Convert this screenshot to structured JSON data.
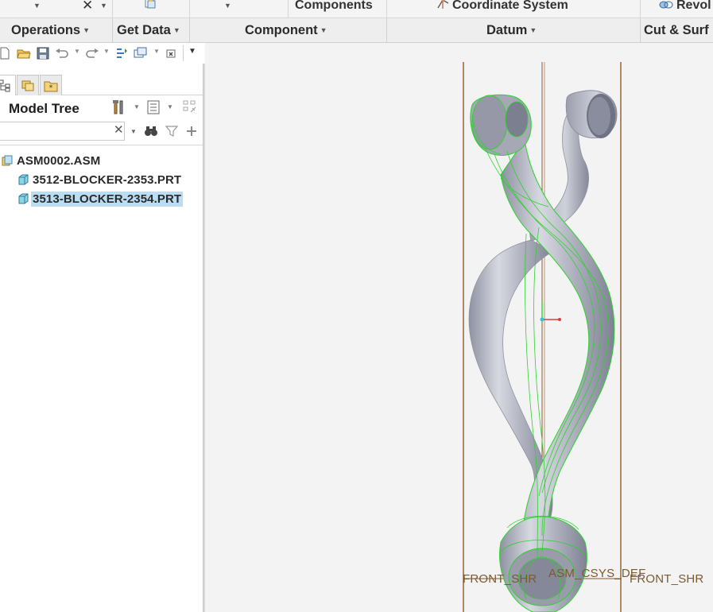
{
  "ribbon_top": {
    "components_label": "Components",
    "coordinate_system_label": "Coordinate System",
    "revolve_label": "Revol"
  },
  "ribbon_groups": {
    "operations": "Operations",
    "get_data": "Get Data",
    "component": "Component",
    "datum": "Datum",
    "cut_surface": "Cut & Surf"
  },
  "quick_access_icons": [
    "new-file-icon",
    "open-file-icon",
    "save-icon",
    "undo-icon",
    "redo-icon",
    "regenerate-icon",
    "windows-icon",
    "close-window-icon",
    "customize-icon"
  ],
  "panel_tabs": [
    "model-tree-tab-icon",
    "folder-browser-tab-icon",
    "favorites-tab-icon"
  ],
  "model_tree": {
    "title": "Model Tree",
    "search_value": "",
    "nodes": [
      {
        "label": "ASM0002.ASM",
        "type": "assembly",
        "level": 0,
        "selected": false
      },
      {
        "label": "3512-BLOCKER-2353.PRT",
        "type": "part",
        "level": 1,
        "selected": false
      },
      {
        "label": "3513-BLOCKER-2354.PRT",
        "type": "part",
        "level": 1,
        "selected": true
      }
    ]
  },
  "viewport": {
    "datum_labels": {
      "front_left": "FRONT_SHR",
      "csys": "ASM_CSYS_DEF",
      "front_right": "FRONT_SHR"
    }
  },
  "colors": {
    "datum_plane": "#8b5a2b",
    "wireframe_highlight": "#2fd12f",
    "part_body": "#a9abb8",
    "selection": "#b9def4"
  }
}
